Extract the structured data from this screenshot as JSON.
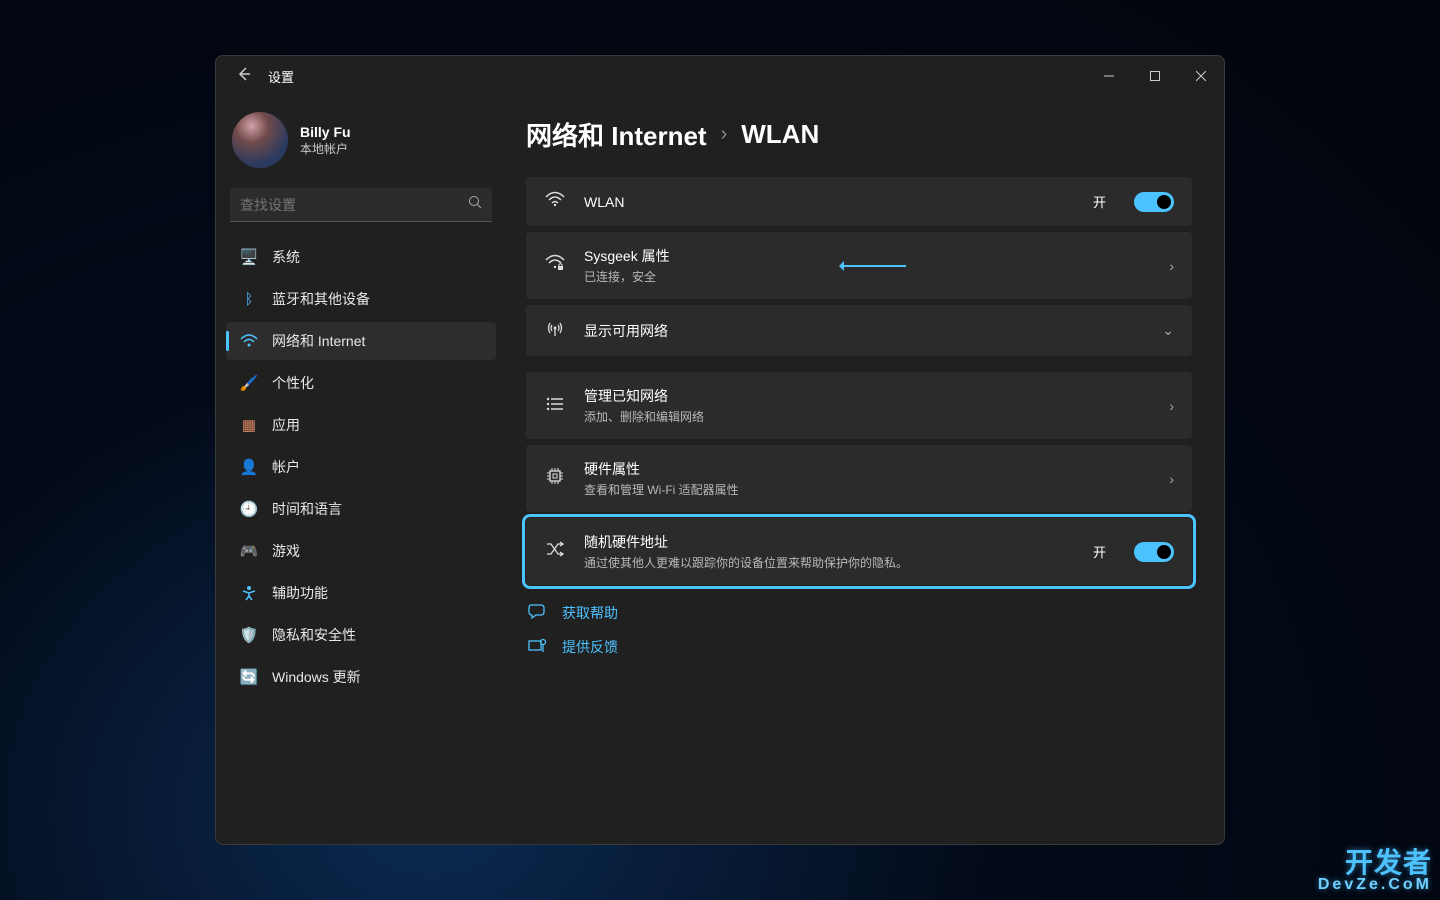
{
  "window": {
    "title": "设置"
  },
  "profile": {
    "name": "Billy Fu",
    "subtitle": "本地帐户"
  },
  "search": {
    "placeholder": "查找设置"
  },
  "nav": {
    "system": "系统",
    "bluetooth": "蓝牙和其他设备",
    "network": "网络和 Internet",
    "personalization": "个性化",
    "apps": "应用",
    "accounts": "帐户",
    "time": "时间和语言",
    "gaming": "游戏",
    "accessibility": "辅助功能",
    "privacy": "隐私和安全性",
    "update": "Windows 更新"
  },
  "breadcrumb": {
    "parent": "网络和 Internet",
    "current": "WLAN"
  },
  "wlan": {
    "label": "WLAN",
    "toggle_label": "开"
  },
  "network_props": {
    "title": "Sysgeek 属性",
    "subtitle": "已连接，安全"
  },
  "available": {
    "title": "显示可用网络"
  },
  "known": {
    "title": "管理已知网络",
    "subtitle": "添加、删除和编辑网络"
  },
  "hardware": {
    "title": "硬件属性",
    "subtitle": "查看和管理 Wi-Fi 适配器属性"
  },
  "random_mac": {
    "title": "随机硬件地址",
    "subtitle": "通过使其他人更难以跟踪你的设备位置来帮助保护你的隐私。",
    "toggle_label": "开"
  },
  "links": {
    "help": "获取帮助",
    "feedback": "提供反馈"
  },
  "watermark": {
    "line1": "开发者",
    "line2": "DevZe.CoM"
  }
}
